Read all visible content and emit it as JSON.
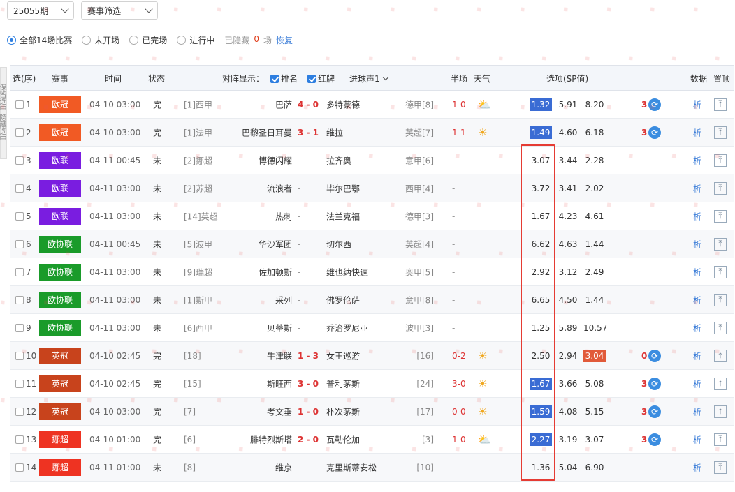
{
  "top": {
    "period_select": "25055期",
    "filter_select": "赛事筛选"
  },
  "filters": {
    "options": [
      "全部14场比赛",
      "未开场",
      "已完场",
      "进行中"
    ],
    "selected": 0,
    "hidden_label": "已隐藏",
    "hidden_count": "0",
    "hidden_unit": "场",
    "restore": "恢复"
  },
  "side_panel": "保留选中 隐藏选中",
  "header": {
    "select": "选(序)",
    "league": "赛事",
    "time": "时间",
    "status": "状态",
    "display": "对阵显示：",
    "rank": "排名",
    "red_card": "红牌",
    "goal_sound": "进球声1",
    "half": "半场",
    "weather": "天气",
    "options": "选项(SP值)",
    "data": "数据",
    "pin": "置顶"
  },
  "colors": {
    "欧冠": "#f15a24",
    "欧联": "#7a1de0",
    "欧协联": "#1a9b2a",
    "英冠": "#c8431c",
    "挪超": "#ee3322",
    "sp_highlight": "#3a6cd4",
    "sp_alt": "#e15a3a",
    "box": "#e53b33"
  },
  "analyze_label": "析",
  "rows": [
    {
      "no": "1",
      "league": "欧冠",
      "time": "04-10 03:00",
      "status": "完",
      "hrank": "[1]西甲",
      "home": "巴萨",
      "score": "4 - 0",
      "away": "多特蒙德",
      "arank": "德甲[8]",
      "half": "1-0",
      "weather": "⛅",
      "sp": [
        "1.32",
        "5.91",
        "8.20"
      ],
      "hl": 0,
      "count": "3",
      "swap": true
    },
    {
      "no": "2",
      "league": "欧冠",
      "time": "04-10 03:00",
      "status": "完",
      "hrank": "[1]法甲",
      "home": "巴黎圣日耳曼",
      "score": "3 - 1",
      "away": "维拉",
      "arank": "英超[7]",
      "half": "1-1",
      "weather": "☀",
      "sp": [
        "1.49",
        "4.60",
        "6.18"
      ],
      "hl": 0,
      "count": "3",
      "swap": true
    },
    {
      "no": "3",
      "league": "欧联",
      "time": "04-11 00:45",
      "status": "未",
      "hrank": "[2]挪超",
      "home": "博德闪耀",
      "score": "-",
      "away": "拉齐奥",
      "arank": "意甲[6]",
      "half": "-",
      "weather": "",
      "sp": [
        "3.07",
        "3.44",
        "2.28"
      ],
      "hl": -1,
      "count": "",
      "swap": false
    },
    {
      "no": "4",
      "league": "欧联",
      "time": "04-11 03:00",
      "status": "未",
      "hrank": "[2]苏超",
      "home": "流浪者",
      "score": "-",
      "away": "毕尔巴鄂",
      "arank": "西甲[4]",
      "half": "-",
      "weather": "",
      "sp": [
        "3.72",
        "3.41",
        "2.02"
      ],
      "hl": -1,
      "count": "",
      "swap": false
    },
    {
      "no": "5",
      "league": "欧联",
      "time": "04-11 03:00",
      "status": "未",
      "hrank": "[14]英超",
      "home": "热刺",
      "score": "-",
      "away": "法兰克福",
      "arank": "德甲[3]",
      "half": "-",
      "weather": "",
      "sp": [
        "1.67",
        "4.23",
        "4.61"
      ],
      "hl": -1,
      "count": "",
      "swap": false
    },
    {
      "no": "6",
      "league": "欧协联",
      "time": "04-11 00:45",
      "status": "未",
      "hrank": "[5]波甲",
      "home": "华沙军团",
      "score": "-",
      "away": "切尔西",
      "arank": "英超[4]",
      "half": "-",
      "weather": "",
      "sp": [
        "6.62",
        "4.63",
        "1.44"
      ],
      "hl": -1,
      "count": "",
      "swap": false
    },
    {
      "no": "7",
      "league": "欧协联",
      "time": "04-11 03:00",
      "status": "未",
      "hrank": "[9]瑞超",
      "home": "佐加顿斯",
      "score": "-",
      "away": "维也纳快速",
      "arank": "奥甲[5]",
      "half": "-",
      "weather": "",
      "sp": [
        "2.92",
        "3.12",
        "2.49"
      ],
      "hl": -1,
      "count": "",
      "swap": false
    },
    {
      "no": "8",
      "league": "欧协联",
      "time": "04-11 03:00",
      "status": "未",
      "hrank": "[1]斯甲",
      "home": "采列",
      "score": "-",
      "away": "佛罗伦萨",
      "arank": "意甲[8]",
      "half": "-",
      "weather": "",
      "sp": [
        "6.65",
        "4.50",
        "1.44"
      ],
      "hl": -1,
      "count": "",
      "swap": false
    },
    {
      "no": "9",
      "league": "欧协联",
      "time": "04-11 03:00",
      "status": "未",
      "hrank": "[6]西甲",
      "home": "贝蒂斯",
      "score": "-",
      "away": "乔治罗尼亚",
      "arank": "波甲[3]",
      "half": "-",
      "weather": "",
      "sp": [
        "1.25",
        "5.89",
        "10.57"
      ],
      "hl": -1,
      "count": "",
      "swap": false
    },
    {
      "no": "10",
      "league": "英冠",
      "time": "04-10 02:45",
      "status": "完",
      "hrank": "[18]",
      "home": "牛津联",
      "score": "1 - 3",
      "away": "女王巡游",
      "arank": "[16]",
      "half": "0-2",
      "weather": "☀",
      "sp": [
        "2.50",
        "2.94",
        "3.04"
      ],
      "hl": 2,
      "count": "0",
      "swap": true
    },
    {
      "no": "11",
      "league": "英冠",
      "time": "04-10 02:45",
      "status": "完",
      "hrank": "[15]",
      "home": "斯旺西",
      "score": "3 - 0",
      "away": "普利茅斯",
      "arank": "[24]",
      "half": "3-0",
      "weather": "☀",
      "sp": [
        "1.67",
        "3.66",
        "5.08"
      ],
      "hl": 0,
      "count": "3",
      "swap": true
    },
    {
      "no": "12",
      "league": "英冠",
      "time": "04-10 03:00",
      "status": "完",
      "hrank": "[7]",
      "home": "考文垂",
      "score": "1 - 0",
      "away": "朴次茅斯",
      "arank": "[17]",
      "half": "0-0",
      "weather": "☀",
      "sp": [
        "1.59",
        "4.08",
        "5.15"
      ],
      "hl": 0,
      "count": "3",
      "swap": true
    },
    {
      "no": "13",
      "league": "挪超",
      "time": "04-10 01:00",
      "status": "完",
      "hrank": "[6]",
      "home": "腓特烈斯塔",
      "score": "2 - 0",
      "away": "瓦勒伦加",
      "arank": "[3]",
      "half": "1-0",
      "weather": "⛅",
      "sp": [
        "2.27",
        "3.19",
        "3.07"
      ],
      "hl": 0,
      "count": "3",
      "swap": true
    },
    {
      "no": "14",
      "league": "挪超",
      "time": "04-11 01:00",
      "status": "未",
      "hrank": "[8]",
      "home": "维京",
      "score": "-",
      "away": "克里斯蒂安松",
      "arank": "[10]",
      "half": "-",
      "weather": "",
      "sp": [
        "1.36",
        "5.04",
        "6.90"
      ],
      "hl": -1,
      "count": "",
      "swap": false
    }
  ]
}
